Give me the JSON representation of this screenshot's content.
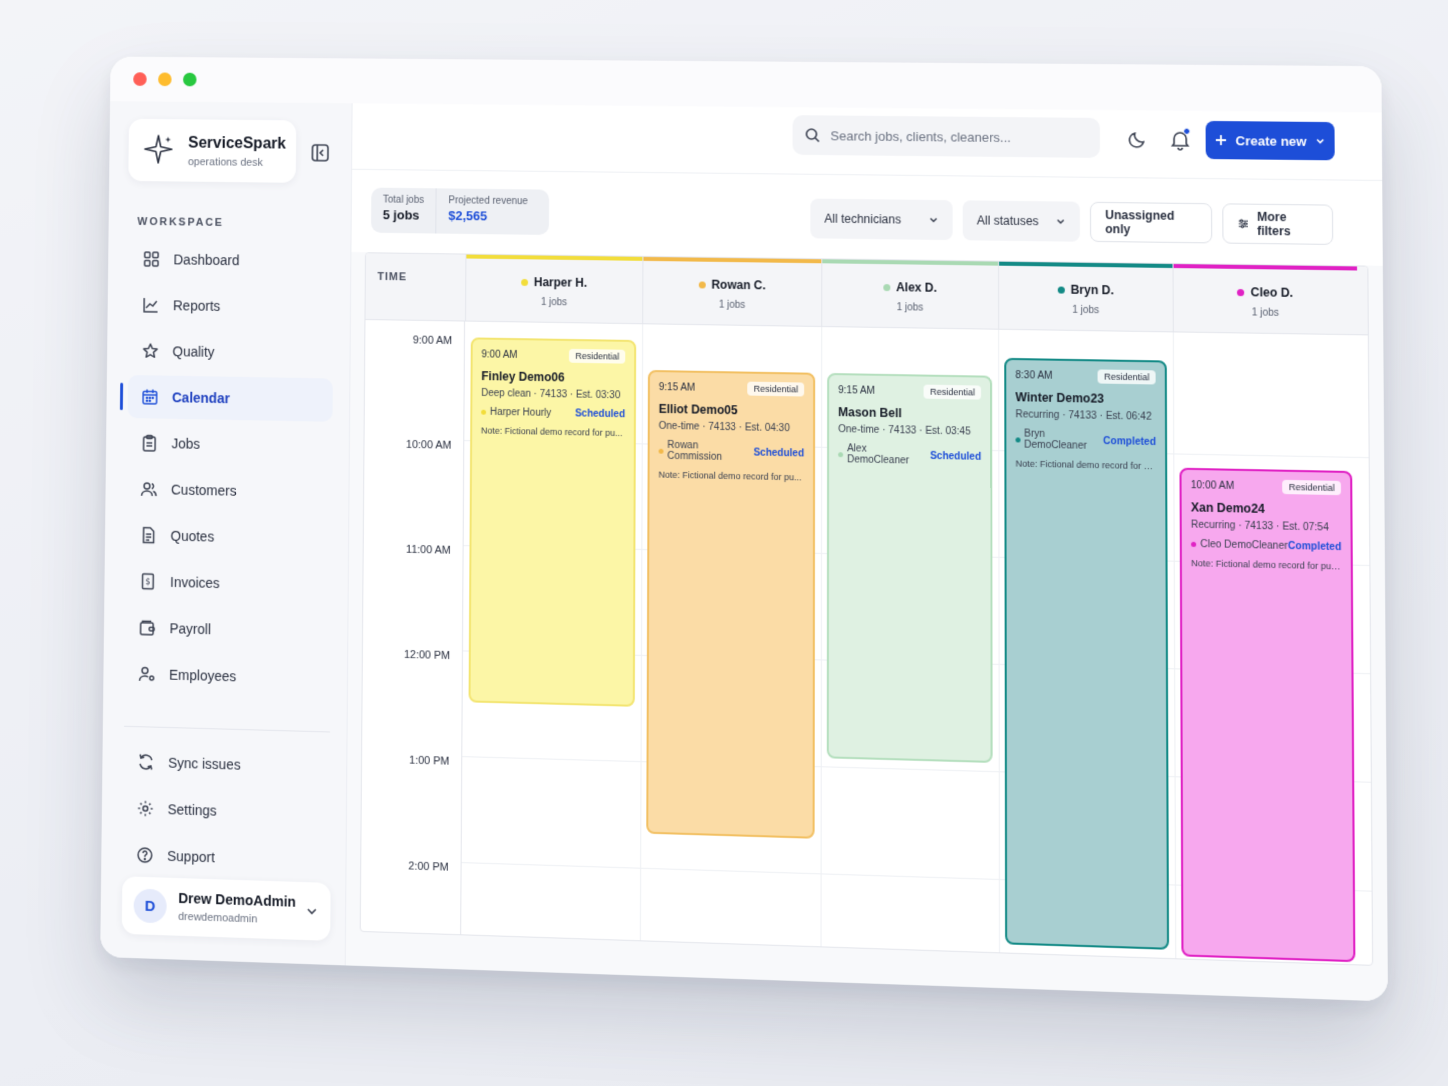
{
  "window": {
    "controls": [
      "close",
      "minimize",
      "maximize"
    ]
  },
  "brand": {
    "name": "ServiceSpark",
    "subtitle": "operations desk",
    "icon": "sparkle-icon"
  },
  "sidebar": {
    "section_label": "WORKSPACE",
    "items": [
      {
        "label": "Dashboard",
        "icon": "grid-icon",
        "active": false
      },
      {
        "label": "Reports",
        "icon": "line-chart-icon",
        "active": false
      },
      {
        "label": "Quality",
        "icon": "star-icon",
        "active": false
      },
      {
        "label": "Calendar",
        "icon": "calendar-icon",
        "active": true
      },
      {
        "label": "Jobs",
        "icon": "clipboard-icon",
        "active": false
      },
      {
        "label": "Customers",
        "icon": "users-icon",
        "active": false
      },
      {
        "label": "Quotes",
        "icon": "document-icon",
        "active": false
      },
      {
        "label": "Invoices",
        "icon": "receipt-icon",
        "active": false
      },
      {
        "label": "Payroll",
        "icon": "wallet-icon",
        "active": false
      },
      {
        "label": "Employees",
        "icon": "user-gear-icon",
        "active": false
      }
    ],
    "secondary_items": [
      {
        "label": "Sync issues",
        "icon": "sync-icon"
      },
      {
        "label": "Settings",
        "icon": "gear-icon"
      },
      {
        "label": "Support",
        "icon": "help-icon"
      }
    ],
    "user": {
      "initial": "D",
      "name": "Drew DemoAdmin",
      "handle": "drewdemoadmin"
    }
  },
  "topbar": {
    "search_placeholder": "Search jobs, clients, cleaners...",
    "create_label": "Create new"
  },
  "stats": {
    "total_jobs_label": "Total jobs",
    "total_jobs_value": "5 jobs",
    "revenue_label": "Projected revenue",
    "revenue_value": "$2,565"
  },
  "filters": {
    "technicians": "All technicians",
    "statuses": "All statuses",
    "unassigned": "Unassigned only",
    "more": "More filters"
  },
  "calendar": {
    "time_header": "TIME",
    "time_labels": [
      "9:00 AM",
      "10:00 AM",
      "11:00 AM",
      "12:00 PM",
      "1:00 PM",
      "2:00 PM"
    ],
    "columns": [
      {
        "name": "Harper H.",
        "count": "1 jobs",
        "color": "#f2dd3b"
      },
      {
        "name": "Rowan C.",
        "count": "1 jobs",
        "color": "#f2b94a"
      },
      {
        "name": "Alex D.",
        "count": "1 jobs",
        "color": "#a9d9b3"
      },
      {
        "name": "Bryn D.",
        "count": "1 jobs",
        "color": "#138a86"
      },
      {
        "name": "Cleo D.",
        "count": "1 jobs",
        "color": "#e021c4"
      }
    ],
    "events": [
      {
        "time": "9:00 AM",
        "tag": "Residential",
        "name": "Finley Demo06",
        "meta": "Deep clean · 74133 · Est. 03:30",
        "cleaner": "Harper Hourly",
        "status": "Scheduled",
        "note": "Note: Fictional demo record for pu..."
      },
      {
        "time": "9:15 AM",
        "tag": "Residential",
        "name": "Elliot Demo05",
        "meta": "One-time · 74133 · Est. 04:30",
        "cleaner": "Rowan Commission",
        "status": "Scheduled",
        "note": "Note: Fictional demo record for pu..."
      },
      {
        "time": "9:15 AM",
        "tag": "Residential",
        "name": "Mason Bell",
        "meta": "One-time · 74133 · Est. 03:45",
        "cleaner": "Alex DemoCleaner",
        "status": "Scheduled",
        "note": ""
      },
      {
        "time": "8:30 AM",
        "tag": "Residential",
        "name": "Winter Demo23",
        "meta": "Recurring · 74133 · Est. 06:42",
        "cleaner": "Bryn DemoCleaner",
        "status": "Completed",
        "note": "Note: Fictional demo record for pu..."
      },
      {
        "time": "10:00 AM",
        "tag": "Residential",
        "name": "Xan Demo24",
        "meta": "Recurring · 74133 · Est. 07:54",
        "cleaner": "Cleo DemoCleaner",
        "status": "Completed",
        "note": "Note: Fictional demo record for pub..."
      }
    ]
  }
}
